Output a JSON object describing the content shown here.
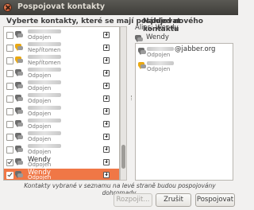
{
  "window": {
    "title": "Pospojovat kontakty"
  },
  "left_panel": {
    "title": "Vyberte kontakty, které se mají pospojovat",
    "contacts": [
      {
        "name": "",
        "status": "Odpojen",
        "icon": "gray-chat-bubble-icon",
        "checked": false,
        "selected": false
      },
      {
        "name": "",
        "status": "Nepřítomen",
        "icon": "yellow-chat-bubble-icon",
        "checked": false,
        "selected": false
      },
      {
        "name": "",
        "status": "Nepřítomen",
        "icon": "yellow-chat-bubble-icon",
        "checked": false,
        "selected": false
      },
      {
        "name": "",
        "status": "Odpojen",
        "icon": "gray-chat-bubble-icon",
        "checked": false,
        "selected": false
      },
      {
        "name": "",
        "status": "Odpojen",
        "icon": "gray-chat-bubble-icon",
        "checked": false,
        "selected": false
      },
      {
        "name": "",
        "status": "Odpojen",
        "icon": "gray-chat-bubble-icon",
        "checked": false,
        "selected": false
      },
      {
        "name": "",
        "status": "Odpojen",
        "icon": "gray-chat-bubble-icon",
        "checked": false,
        "selected": false
      },
      {
        "name": "",
        "status": "Odpojen",
        "icon": "gray-chat-bubble-icon",
        "checked": false,
        "selected": false
      },
      {
        "name": "",
        "status": "Odpojen",
        "icon": "gray-chat-bubble-icon",
        "checked": false,
        "selected": false
      },
      {
        "name": "",
        "status": "Odpojen",
        "icon": "gray-chat-bubble-icon",
        "checked": false,
        "selected": false
      },
      {
        "name": "Wendy",
        "status": "Odpojen",
        "icon": "gray-chat-bubble-icon",
        "checked": true,
        "selected": false
      },
      {
        "name": "Wendy",
        "status": "Odpojen",
        "icon": "gray-chat-bubble-icon",
        "checked": true,
        "selected": true
      }
    ]
  },
  "right_panel": {
    "title": "Náhled nového kontaktu",
    "alias": "Alias: Wendy",
    "contact_name": "Wendy",
    "contact_status": "Odpojen",
    "preview_items": [
      {
        "jabber": "@jabber.org",
        "status": "Odpojen",
        "icon": "gray-chat-bubble-icon"
      },
      {
        "jabber": "",
        "status": "Odpojen",
        "icon": "yellow-chat-bubble-icon"
      }
    ]
  },
  "info_text": "Kontakty vybrané v seznamu na levé straně budou pospojovány dohromady.",
  "buttons": {
    "merge": "Rozpojit...",
    "cancel": "Zrušit",
    "combine": "Pospojovat"
  },
  "colors": {
    "selection": "#f07746",
    "titlebar": "#3e3d39",
    "away": "#e9a813"
  }
}
